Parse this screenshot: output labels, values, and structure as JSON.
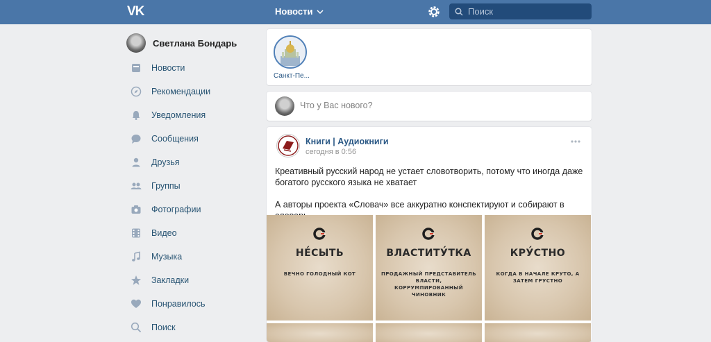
{
  "header": {
    "logo": "VK",
    "title": "Новости",
    "search_placeholder": "Поиск"
  },
  "profile": {
    "name": "Светлана Бондарь"
  },
  "sidebar": {
    "items": [
      {
        "label": "Новости",
        "icon": "news-icon"
      },
      {
        "label": "Рекомендации",
        "icon": "compass-icon"
      },
      {
        "label": "Уведомления",
        "icon": "bell-icon"
      },
      {
        "label": "Сообщения",
        "icon": "chat-bubble-icon"
      },
      {
        "label": "Друзья",
        "icon": "person-icon"
      },
      {
        "label": "Группы",
        "icon": "group-icon"
      },
      {
        "label": "Фотографии",
        "icon": "camera-icon"
      },
      {
        "label": "Видео",
        "icon": "film-icon"
      },
      {
        "label": "Музыка",
        "icon": "music-note-icon"
      },
      {
        "label": "Закладки",
        "icon": "star-icon"
      },
      {
        "label": "Понравилось",
        "icon": "heart-icon"
      },
      {
        "label": "Поиск",
        "icon": "search-icon"
      }
    ]
  },
  "stories": {
    "items": [
      {
        "label": "Санкт-Пе..."
      }
    ]
  },
  "compose": {
    "placeholder": "Что у Вас нового?"
  },
  "post": {
    "author": "Книги | Аудиокниги",
    "time": "сегодня в 0:56",
    "text_1": "Креативный русский народ не устает словотворить, потому что иногда даже богатого русского языка не хватает",
    "text_2": "А авторы проекта «Словач» все аккуратно конспектируют и собирают в словарь.",
    "tiles": [
      {
        "word": "НЕ́СЫТЬ",
        "definition": "ВЕЧНО ГОЛОДНЫЙ КОТ"
      },
      {
        "word": "ВЛАСТИТУ́ТКА",
        "definition": "ПРОДАЖНЫЙ ПРЕДСТАВИТЕЛЬ ВЛАСТИ, КОРРУМПИРОВАННЫЙ ЧИНОВНИК"
      },
      {
        "word": "КРУ́СТНО",
        "definition": "КОГДА В НАЧАЛЕ КРУТО, А ЗАТЕМ ГРУСТНО"
      }
    ]
  },
  "colors": {
    "header_bg": "#4a76a8",
    "link": "#2a5885",
    "nav_text": "#285473",
    "page_bg": "#edeef0"
  }
}
